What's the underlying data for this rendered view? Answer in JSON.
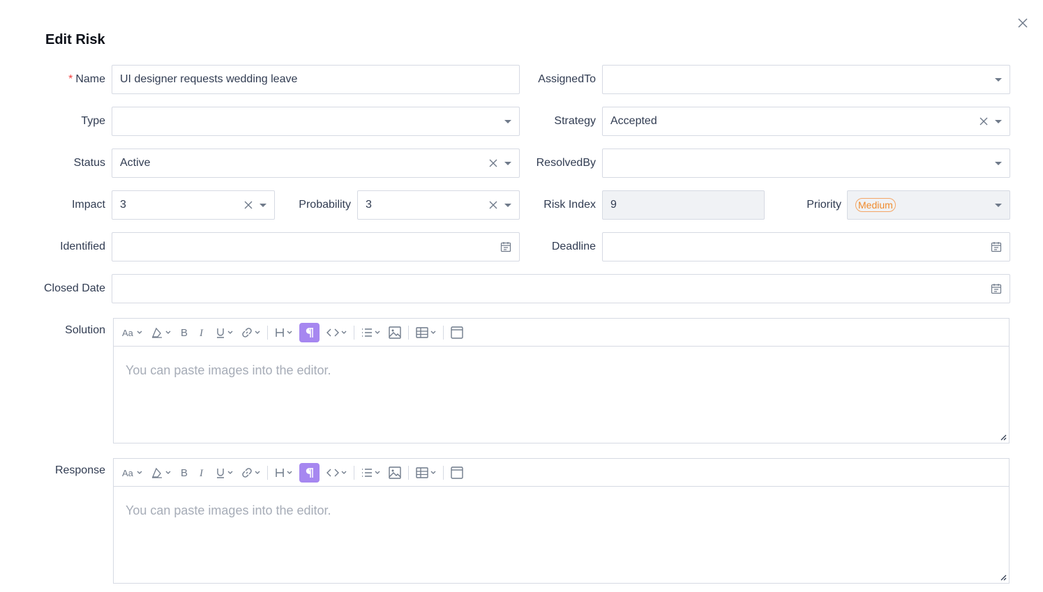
{
  "dialog": {
    "title": "Edit Risk"
  },
  "fields": {
    "name": {
      "label": "Name",
      "required_mark": "*",
      "value": "UI designer requests wedding leave"
    },
    "assigned_to": {
      "label": "AssignedTo",
      "value": ""
    },
    "type": {
      "label": "Type",
      "value": ""
    },
    "strategy": {
      "label": "Strategy",
      "value": "Accepted"
    },
    "status": {
      "label": "Status",
      "value": "Active"
    },
    "resolved_by": {
      "label": "ResolvedBy",
      "value": ""
    },
    "impact": {
      "label": "Impact",
      "value": "3"
    },
    "probability": {
      "label": "Probability",
      "value": "3"
    },
    "risk_index": {
      "label": "Risk Index",
      "value": "9"
    },
    "priority": {
      "label": "Priority",
      "value": "Medium"
    },
    "identified": {
      "label": "Identified",
      "value": ""
    },
    "deadline": {
      "label": "Deadline",
      "value": ""
    },
    "closed_date": {
      "label": "Closed Date",
      "value": ""
    }
  },
  "editors": {
    "solution": {
      "label": "Solution",
      "placeholder": "You can paste images into the editor."
    },
    "response": {
      "label": "Response",
      "placeholder": "You can paste images into the editor."
    }
  },
  "colors": {
    "accent": "#a687f0",
    "priority_medium": "#f08b2d",
    "required": "#f23e3e",
    "border": "#d6dae3"
  },
  "icons": {
    "close": "close-icon",
    "caret": "caret-down-icon",
    "clear": "clear-icon",
    "calendar": "calendar-icon",
    "toolbar": [
      "font-size-icon",
      "text-color-icon",
      "bold-icon",
      "italic-icon",
      "underline-icon",
      "link-icon",
      "heading-icon",
      "paragraph-icon",
      "code-icon",
      "list-icon",
      "image-icon",
      "table-icon",
      "fullscreen-icon"
    ]
  }
}
